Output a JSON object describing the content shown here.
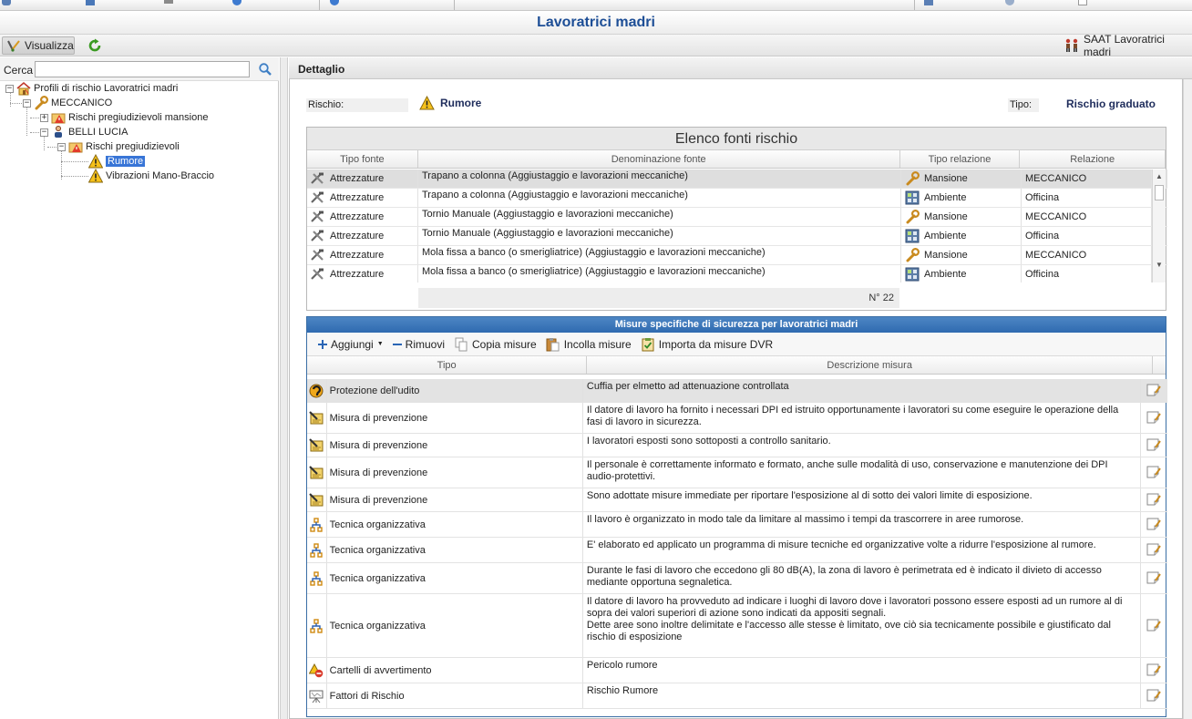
{
  "window": {
    "title": "Lavoratrici madri"
  },
  "toolbar": {
    "view_label": "Visualizza",
    "app_label": "SAAT Lavoratrici madri"
  },
  "left": {
    "search_label": "Cerca",
    "search_value": "",
    "tree": {
      "root": "Profili di rischio Lavoratrici madri",
      "mansione": "MECCANICO",
      "rischi_mansione": "Rischi pregiudizievoli mansione",
      "lavoratore": "BELLI LUCIA",
      "rischi": "Rischi pregiudizievoli",
      "rumore": "Rumore",
      "vibrazioni": "Vibrazioni Mano-Braccio"
    }
  },
  "detail": {
    "header": "Dettaglio",
    "rischio_label": "Rischio:",
    "rischio_value": "Rumore",
    "tipo_label": "Tipo:",
    "tipo_value": "Rischio graduato"
  },
  "fonti": {
    "title": "Elenco fonti rischio",
    "columns": [
      "Tipo fonte",
      "Denominazione fonte",
      "Tipo relazione",
      "Relazione"
    ],
    "rows": [
      {
        "tipo": "Attrezzature",
        "nome": "Trapano a colonna (Aggiustaggio e lavorazioni meccaniche)",
        "rel_tipo": "Mansione",
        "rel": "MECCANICO"
      },
      {
        "tipo": "Attrezzature",
        "nome": "Trapano a colonna (Aggiustaggio e lavorazioni meccaniche)",
        "rel_tipo": "Ambiente",
        "rel": "Officina"
      },
      {
        "tipo": "Attrezzature",
        "nome": "Tornio Manuale (Aggiustaggio e lavorazioni meccaniche)",
        "rel_tipo": "Mansione",
        "rel": "MECCANICO"
      },
      {
        "tipo": "Attrezzature",
        "nome": "Tornio Manuale (Aggiustaggio e lavorazioni meccaniche)",
        "rel_tipo": "Ambiente",
        "rel": "Officina"
      },
      {
        "tipo": "Attrezzature",
        "nome": "Mola fissa a banco (o smerigliatrice) (Aggiustaggio e lavorazioni meccaniche)",
        "rel_tipo": "Mansione",
        "rel": "MECCANICO"
      },
      {
        "tipo": "Attrezzature",
        "nome": "Mola fissa a banco (o smerigliatrice) (Aggiustaggio e lavorazioni meccaniche)",
        "rel_tipo": "Ambiente",
        "rel": "Officina"
      }
    ],
    "count": "N° 22"
  },
  "misure": {
    "title": "Misure specifiche di sicurezza per lavoratrici madri",
    "tools": {
      "add": "Aggiungi",
      "remove": "Rimuovi",
      "copy": "Copia misure",
      "paste": "Incolla misure",
      "import": "Importa da misure DVR"
    },
    "columns": [
      "Tipo",
      "Descrizione misura"
    ],
    "rows": [
      {
        "icon": "ear-icon",
        "tipo": "Protezione dell'udito",
        "desc": "Cuffia per elmetto ad attenuazione controllata"
      },
      {
        "icon": "note-icon",
        "tipo": "Misura di prevenzione",
        "desc": "Il datore di lavoro ha fornito i necessari DPI ed istruito opportunamente i lavoratori su come eseguire le operazione della fasi di lavoro in sicurezza."
      },
      {
        "icon": "note-icon",
        "tipo": "Misura di prevenzione",
        "desc": "I lavoratori esposti sono sottoposti a controllo sanitario."
      },
      {
        "icon": "note-icon",
        "tipo": "Misura di prevenzione",
        "desc": "Il personale è correttamente informato e formato, anche sulle modalità di uso, conservazione e manutenzione dei DPI audio-protettivi."
      },
      {
        "icon": "note-icon",
        "tipo": "Misura di prevenzione",
        "desc": "Sono adottate misure immediate per riportare l'esposizione al di sotto dei valori limite di esposizione."
      },
      {
        "icon": "org-icon",
        "tipo": "Tecnica organizzativa",
        "desc": "Il lavoro è organizzato in modo tale da limitare al massimo i tempi da trascorrere in aree rumorose."
      },
      {
        "icon": "org-icon",
        "tipo": "Tecnica organizzativa",
        "desc": "E' elaborato ed applicato un programma di misure tecniche ed organizzative volte a ridurre l'esposizione al rumore."
      },
      {
        "icon": "org-icon",
        "tipo": "Tecnica organizzativa",
        "desc": "Durante le fasi di lavoro che eccedono gli 80 dB(A), la zona di lavoro è perimetrata ed è indicato il divieto di accesso mediante opportuna segnaletica."
      },
      {
        "icon": "org-icon",
        "tipo": "Tecnica organizzativa",
        "desc": "Il datore di lavoro ha provveduto ad indicare i luoghi di lavoro dove i lavoratori possono essere esposti ad un rumore al di sopra dei valori superiori di azione sono indicati da appositi segnali.\n Dette aree sono inoltre delimitate e l'accesso alle stesse è limitato, ove ciò sia tecnicamente possibile e giustificato dal rischio di esposizione"
      },
      {
        "icon": "sign-icon",
        "tipo": "Cartelli di avvertimento",
        "desc": "Pericolo rumore"
      },
      {
        "icon": "easel-icon",
        "tipo": "Fattori di Rischio",
        "desc": "Rischio Rumore"
      }
    ]
  },
  "colors": {
    "title": "#1d4e96",
    "panel_head": "#3a6ea5",
    "selection": "#3875d7"
  }
}
